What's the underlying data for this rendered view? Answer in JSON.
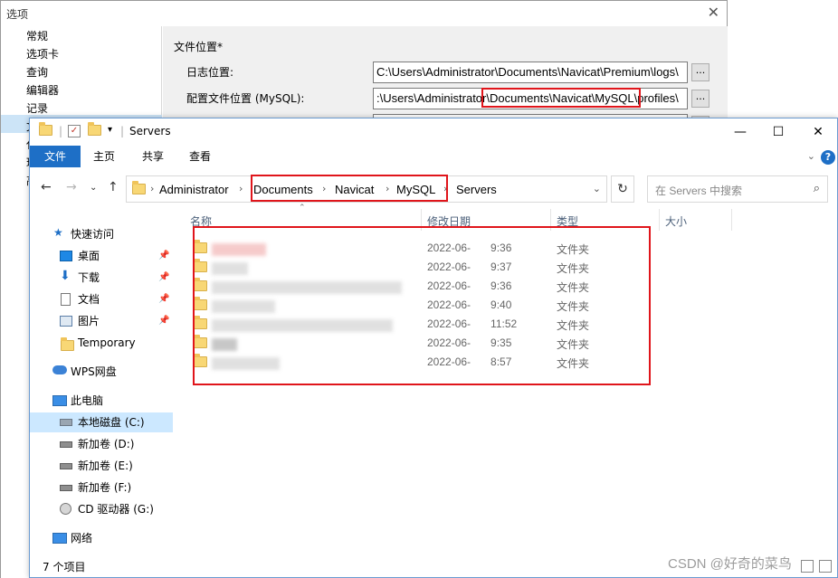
{
  "options_dialog": {
    "title": "选项",
    "nav_items": [
      "常规",
      "选项卡",
      "查询",
      "编辑器",
      "记录"
    ],
    "nav_partial": [
      "文",
      "代",
      "环",
      "高"
    ],
    "section_title": "文件位置*",
    "log_label": "日志位置:",
    "log_value": "C:\\Users\\Administrator\\Documents\\Navicat\\Premium\\logs\\",
    "profile_label": "配置文件位置 (MySQL):",
    "profile_value": ":\\Users\\Administrator\\Documents\\Navicat\\MySQL\\profiles\\",
    "browse_label": "..."
  },
  "explorer": {
    "title": "Servers",
    "ribbon_tabs": [
      "文件",
      "主页",
      "共享",
      "查看"
    ],
    "help_label": "?",
    "breadcrumb": [
      "Administrator",
      "Documents",
      "Navicat",
      "MySQL",
      "Servers"
    ],
    "search_placeholder": "在 Servers 中搜索",
    "sidebar": [
      {
        "label": "快速访问",
        "icon": "star-icon",
        "pinned": false
      },
      {
        "label": "桌面",
        "icon": "desktop-icon",
        "pinned": true
      },
      {
        "label": "下载",
        "icon": "download-icon",
        "pinned": true
      },
      {
        "label": "文档",
        "icon": "document-icon",
        "pinned": true
      },
      {
        "label": "图片",
        "icon": "picture-icon",
        "pinned": true
      },
      {
        "label": "Temporary",
        "icon": "folder-icon",
        "pinned": false
      },
      {
        "label": "WPS网盘",
        "icon": "cloud-icon",
        "pinned": false
      },
      {
        "label": "此电脑",
        "icon": "computer-icon",
        "pinned": false
      },
      {
        "label": "本地磁盘 (C:)",
        "icon": "drive-icon",
        "pinned": false
      },
      {
        "label": "新加卷 (D:)",
        "icon": "drive-icon",
        "pinned": false
      },
      {
        "label": "新加卷 (E:)",
        "icon": "drive-icon",
        "pinned": false
      },
      {
        "label": "新加卷 (F:)",
        "icon": "drive-icon",
        "pinned": false
      },
      {
        "label": "CD 驱动器 (G:)",
        "icon": "cd-drive-icon",
        "pinned": false
      },
      {
        "label": "网络",
        "icon": "network-icon",
        "pinned": false
      }
    ],
    "columns": [
      "名称",
      "修改日期",
      "类型",
      "大小"
    ],
    "files": [
      {
        "date": "2022-06-",
        "time": "9:36",
        "type": "文件夹"
      },
      {
        "date": "2022-06-",
        "time": "9:37",
        "type": "文件夹"
      },
      {
        "date": "2022-06-",
        "time": "9:36",
        "type": "文件夹"
      },
      {
        "date": "2022-06-",
        "time": "9:40",
        "type": "文件夹"
      },
      {
        "date": "2022-06-",
        "time": "11:52",
        "type": "文件夹"
      },
      {
        "date": "2022-06-",
        "time": "9:35",
        "type": "文件夹"
      },
      {
        "date": "2022-06-",
        "time": "8:57",
        "type": "文件夹"
      }
    ],
    "status": "7 个项目"
  },
  "watermark": "CSDN @好奇的菜鸟",
  "colors": {
    "accent": "#1e6fc6",
    "highlight": "#e0151b",
    "selection": "#cce8ff"
  }
}
